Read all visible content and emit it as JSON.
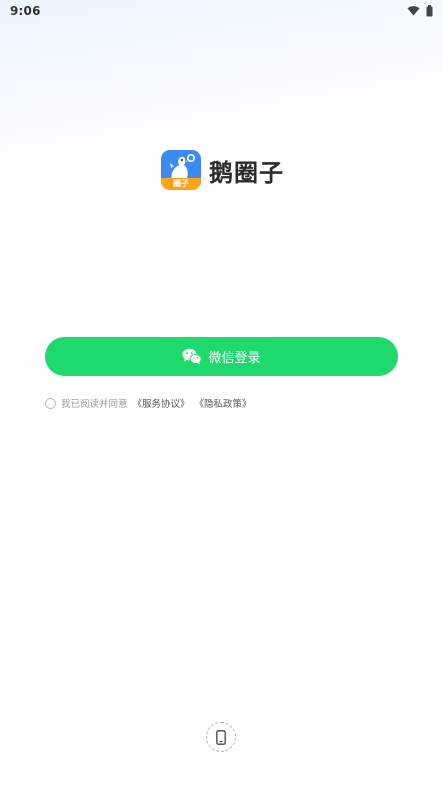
{
  "status_bar": {
    "time": "9:06",
    "icons": [
      "wifi-icon",
      "battery-icon"
    ]
  },
  "app": {
    "name": "鹅圈子",
    "icon_badge": "圈子",
    "icon_name": "goose-app-icon"
  },
  "login": {
    "wechat_label": "微信登录",
    "wechat_icon": "wechat-icon"
  },
  "agreement": {
    "prefix": "我已阅读并同意",
    "service": "《服务协议》",
    "privacy": "《隐私政策》"
  },
  "other_login": {
    "icon": "phone-icon"
  },
  "colors": {
    "primary_green": "#1fd96d",
    "app_blue": "#3c8bf3",
    "app_orange": "#ffa31a"
  }
}
